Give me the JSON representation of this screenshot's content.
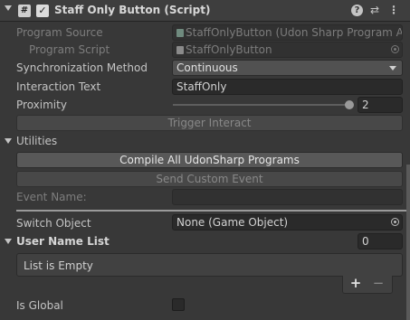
{
  "header": {
    "title": "Staff Only Button (Script)",
    "script_icon_glyph": "#",
    "enabled_check": "✓",
    "help_glyph": "?",
    "preset_glyph": "⇄",
    "menu_glyph": "⋮"
  },
  "program_source": {
    "label": "Program Source",
    "value": "StaffOnlyButton (Udon Sharp Program A"
  },
  "program_script": {
    "label": "Program Script",
    "value": "StaffOnlyButton"
  },
  "sync_method": {
    "label": "Synchronization Method",
    "value": "Continuous"
  },
  "interaction_text": {
    "label": "Interaction Text",
    "value": "StaffOnly"
  },
  "proximity": {
    "label": "Proximity",
    "value": "2",
    "fraction": 1.0
  },
  "trigger_interact": {
    "label": "Trigger Interact"
  },
  "utilities": {
    "label": "Utilities",
    "compile_label": "Compile All UdonSharp Programs",
    "send_event_label": "Send Custom Event",
    "event_name_label": "Event Name:",
    "event_name_value": ""
  },
  "switch_object": {
    "label": "Switch Object",
    "value": "None (Game Object)"
  },
  "user_name_list": {
    "label": "User Name List",
    "count": "0",
    "empty_text": "List is Empty",
    "add_glyph": "+",
    "remove_glyph": "−"
  },
  "is_global": {
    "label": "Is Global",
    "checked": false
  },
  "colors": {
    "background": "#383838",
    "field": "#2a2a2a",
    "button": "#585858"
  }
}
